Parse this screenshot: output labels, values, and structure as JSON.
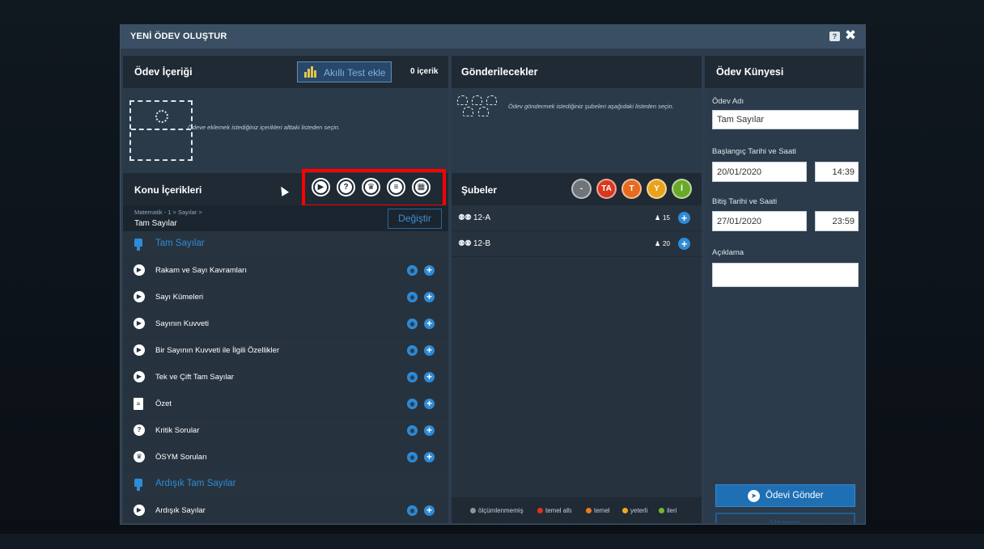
{
  "modal": {
    "title": "YENİ ÖDEV OLUŞTUR",
    "help_icon": "?",
    "close_icon": "✖"
  },
  "left": {
    "header": "Ödev İçeriği",
    "smart_test_label": "Akıllı Test ekle",
    "count_label": "0 içerik",
    "empty_text": "Ödeve eklemek istediğiniz içerikleri alttaki listeden seçin.",
    "konu_title": "Konu İçerikleri",
    "tools": [
      {
        "name": "video-tool",
        "glyph": "▶"
      },
      {
        "name": "question-tool",
        "glyph": "?"
      },
      {
        "name": "osym-tool",
        "glyph": "♛"
      },
      {
        "name": "document-tool",
        "glyph": "≡"
      },
      {
        "name": "test-tool",
        "glyph": "▦"
      }
    ],
    "breadcrumb": "Matematik - 1 > Sayılar >",
    "current": "Tam Sayılar",
    "change_label": "Değiştir",
    "rows": [
      {
        "kind": "section",
        "label": "Tam Sayılar"
      },
      {
        "kind": "video",
        "icon": "▶",
        "label": "Rakam ve Sayı Kavramları"
      },
      {
        "kind": "video",
        "icon": "▶",
        "label": "Sayı Kümeleri"
      },
      {
        "kind": "video",
        "icon": "▶",
        "label": "Sayının Kuvveti"
      },
      {
        "kind": "video",
        "icon": "▶",
        "label": "Bir Sayının Kuvveti ile İlgili Özellikler"
      },
      {
        "kind": "video",
        "icon": "▶",
        "label": "Tek ve Çift Tam Sayılar"
      },
      {
        "kind": "doc",
        "icon": "≡",
        "label": "Özet"
      },
      {
        "kind": "question",
        "icon": "?",
        "label": "Kritik Sorular"
      },
      {
        "kind": "osym",
        "icon": "♛",
        "label": "ÖSYM Soruları"
      },
      {
        "kind": "section",
        "label": "Ardışık Tam Sayılar"
      },
      {
        "kind": "video",
        "icon": "▶",
        "label": "Ardışık Sayılar"
      }
    ]
  },
  "middle": {
    "header": "Gönderilecekler",
    "empty_text": "Ödev göndermek istediğiniz şubeleri aşağıdaki listeden seçin.",
    "subeler_title": "Şubeler",
    "levels": [
      {
        "label": "-",
        "color": "#6f7478"
      },
      {
        "label": "TA",
        "color": "#d9381e"
      },
      {
        "label": "T",
        "color": "#e66a1f"
      },
      {
        "label": "Y",
        "color": "#e8a21c"
      },
      {
        "label": "İ",
        "color": "#6aa82a"
      }
    ],
    "sections": [
      {
        "name": "12-A",
        "count": "15"
      },
      {
        "name": "12-B",
        "count": "20"
      }
    ],
    "legend": [
      {
        "label": "ölçümlenmemiş",
        "color": "#8e9499"
      },
      {
        "label": "temel altı",
        "color": "#e0321a"
      },
      {
        "label": "temel",
        "color": "#ef7b1a"
      },
      {
        "label": "yeterli",
        "color": "#f0a81c"
      },
      {
        "label": "ileri",
        "color": "#74b72d"
      }
    ]
  },
  "right": {
    "header": "Ödev Künyesi",
    "name_label": "Ödev Adı",
    "name_value": "Tam Sayılar",
    "start_label": "Başlangıç Tarihi ve Saati",
    "start_date": "20/01/2020",
    "start_time": "14:39",
    "end_label": "Bitiş Tarihi ve Saati",
    "end_date": "27/01/2020",
    "end_time": "23:59",
    "desc_label": "Açıklama",
    "desc_value": "",
    "send_label": "Ödevi Gönder",
    "cancel_label": "Vazgeç"
  }
}
